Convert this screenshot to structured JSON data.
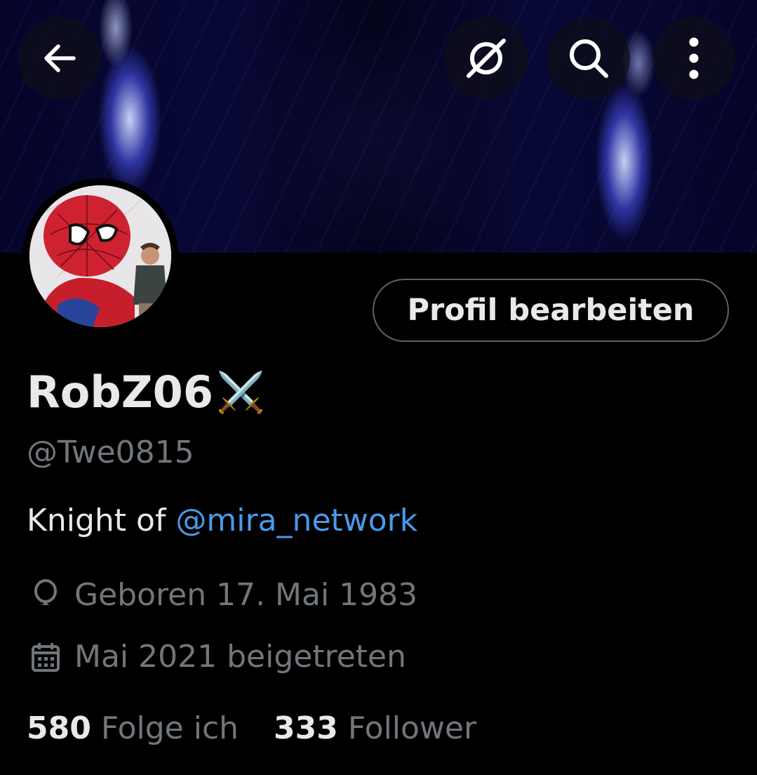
{
  "header": {
    "back_icon": "arrow-left-icon",
    "hide_icon": "slashed-circle-icon",
    "search_icon": "search-icon",
    "more_icon": "more-vertical-icon"
  },
  "profile": {
    "edit_label": "Profil bearbeiten",
    "display_name": "RobZ06",
    "name_badge": "⚔️",
    "handle": "@Twe0815",
    "bio_prefix": "Knight of ",
    "bio_mention": "@mira_network",
    "birthday": "Geboren 17. Mai 1983",
    "joined": "Mai 2021 beigetreten",
    "following_count": "580",
    "following_label": "Folge ich",
    "followers_count": "333",
    "followers_label": "Follower"
  },
  "colors": {
    "background": "#000000",
    "text_primary": "#e7e9ea",
    "text_secondary": "#71767b",
    "link": "#4a99e9",
    "button_border": "#536471"
  }
}
